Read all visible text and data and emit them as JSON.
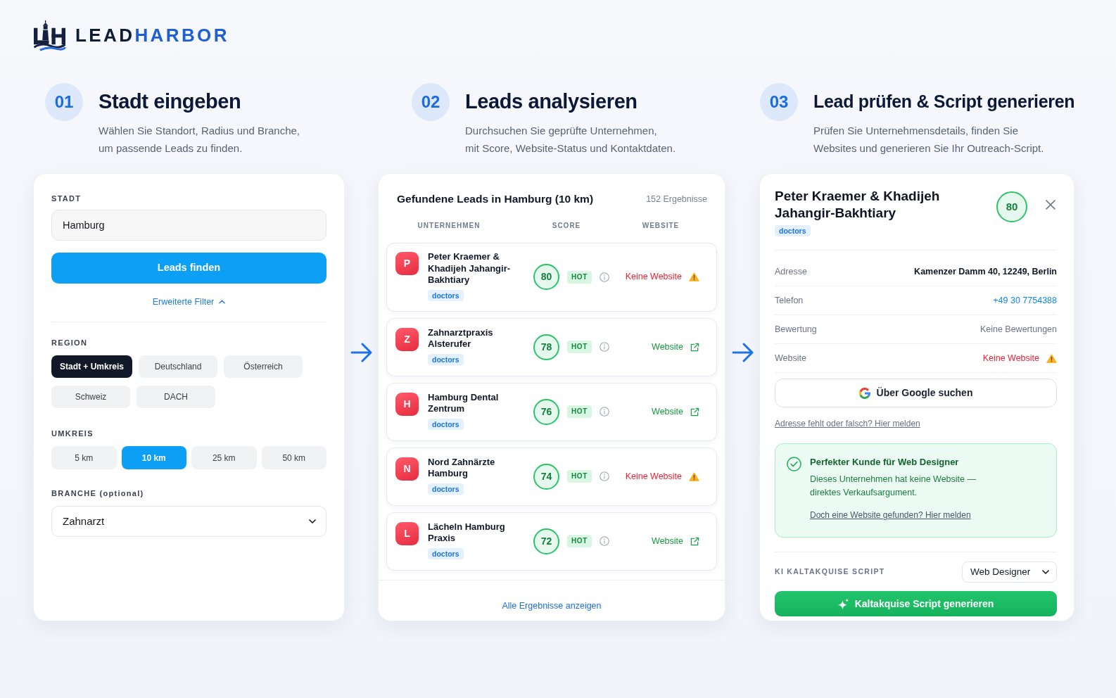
{
  "logo": {
    "wordmark_dark": "LEAD",
    "wordmark_accent": "HARBOR"
  },
  "steps": [
    {
      "number": "01",
      "title": "Stadt eingeben",
      "description": "Wählen Sie Standort, Radius und Branche,\num passende Leads zu finden."
    },
    {
      "number": "02",
      "title": "Leads analysieren",
      "description": "Durchsuchen Sie geprüfte Unternehmen,\nmit Score, Website-Status und Kontaktdaten."
    },
    {
      "number": "03",
      "title": "Lead prüfen & Script generieren",
      "description": "Prüfen Sie Unternehmensdetails, finden Sie\nWebsites und generieren Sie Ihr Outreach-Script."
    }
  ],
  "search_panel": {
    "city": {
      "label": "STADT",
      "value": "Hamburg"
    },
    "search_button": "Leads finden",
    "advanced_filters": {
      "label": "Erweiterte Filter",
      "expanded": true
    },
    "region": {
      "label": "REGION",
      "options": [
        {
          "label": "Stadt + Umkreis",
          "selected": true
        },
        {
          "label": "Deutschland",
          "selected": false
        },
        {
          "label": "Österreich",
          "selected": false
        },
        {
          "label": "Schweiz",
          "selected": false
        },
        {
          "label": "DACH",
          "selected": false
        }
      ]
    },
    "radius": {
      "label": "UMKREIS",
      "options": [
        {
          "label": "5 km",
          "selected": false
        },
        {
          "label": "10 km",
          "selected": true
        },
        {
          "label": "25 km",
          "selected": false
        },
        {
          "label": "50 km",
          "selected": false
        }
      ]
    },
    "industry": {
      "label": "BRANCHE (optional)",
      "value": "Zahnarzt"
    }
  },
  "results": {
    "title": "Gefundene Leads in Hamburg (10 km)",
    "count": "152 Ergebnisse",
    "columns": [
      "UNTERNEHMEN",
      "SCORE",
      "WEBSITE"
    ],
    "rows": [
      {
        "initial": "P",
        "name": "Peter Kraemer & Khadijeh Jahangir-Bakhtiary",
        "tag": "doctors",
        "score": "80",
        "badge": "HOT",
        "website": {
          "kind": "missing",
          "label": "Keine Website"
        }
      },
      {
        "initial": "Z",
        "name": "Zahnarztpraxis Alsterufer",
        "tag": "doctors",
        "score": "78",
        "badge": "HOT",
        "website": {
          "kind": "link",
          "label": "Website"
        }
      },
      {
        "initial": "H",
        "name": "Hamburg Dental Zentrum",
        "tag": "doctors",
        "score": "76",
        "badge": "HOT",
        "website": {
          "kind": "link",
          "label": "Website"
        }
      },
      {
        "initial": "N",
        "name": "Nord Zahnärzte Hamburg",
        "tag": "doctors",
        "score": "74",
        "badge": "HOT",
        "website": {
          "kind": "missing",
          "label": "Keine Website"
        }
      },
      {
        "initial": "L",
        "name": "Lächeln Hamburg Praxis",
        "tag": "doctors",
        "score": "72",
        "badge": "HOT",
        "website": {
          "kind": "link",
          "label": "Website"
        }
      }
    ],
    "show_all": "Alle Ergebnisse anzeigen"
  },
  "detail": {
    "name": "Peter Kraemer & Khadijeh Jahangir-Bakhtiary",
    "tag": "doctors",
    "score": "80",
    "fields": [
      {
        "kind": "text",
        "label": "Adresse",
        "value": "Kamenzer Damm 40, 12249, Berlin"
      },
      {
        "kind": "phone",
        "label": "Telefon",
        "value": "+49 30 7754388"
      },
      {
        "kind": "muted",
        "label": "Bewertung",
        "value": "Keine Bewertungen"
      },
      {
        "kind": "missing",
        "label": "Website",
        "value": "Keine Website"
      }
    ],
    "google_button": "Über Google suchen",
    "report_link": "Adresse fehlt oder falsch? Hier melden",
    "recommendation": {
      "title": "Perfekter Kunde für Web Designer",
      "text": "Dieses Unternehmen hat keine Website —\ndirektes Verkaufsargument.",
      "link": "Doch eine Website gefunden? Hier melden"
    },
    "script": {
      "label": "KI KALTAKQUISE SCRIPT",
      "role": "Web Designer",
      "button": "Kaltakquise Script generieren"
    }
  }
}
